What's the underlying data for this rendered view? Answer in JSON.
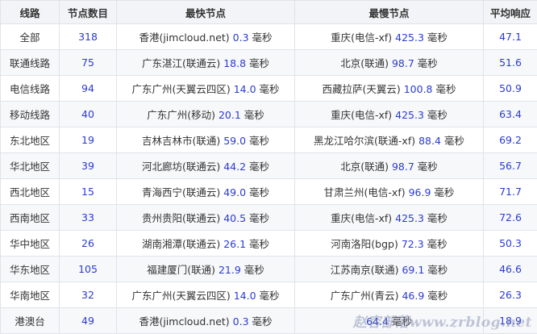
{
  "headers": [
    "线路",
    "节点数目",
    "最快节点",
    "最慢节点",
    "平均响应"
  ],
  "rows": [
    {
      "line": "全部",
      "count": "318",
      "fast_name": "香港(jimcloud.net)",
      "fast_ms": "0.3",
      "slow_name": "重庆(电信-xf)",
      "slow_ms": "425.3",
      "avg": "47.1"
    },
    {
      "line": "联通线路",
      "count": "75",
      "fast_name": "广东湛江(联通云)",
      "fast_ms": "18.8",
      "slow_name": "北京(联通)",
      "slow_ms": "98.7",
      "avg": "51.6"
    },
    {
      "line": "电信线路",
      "count": "94",
      "fast_name": "广东广州(天翼云四区)",
      "fast_ms": "14.0",
      "slow_name": "西藏拉萨(天翼云)",
      "slow_ms": "100.8",
      "avg": "50.9"
    },
    {
      "line": "移动线路",
      "count": "40",
      "fast_name": "广东广州(移动)",
      "fast_ms": "20.1",
      "slow_name": "重庆(电信-xf)",
      "slow_ms": "425.3",
      "avg": "63.4"
    },
    {
      "line": "东北地区",
      "count": "19",
      "fast_name": "吉林吉林市(联通)",
      "fast_ms": "59.0",
      "slow_name": "黑龙江哈尔滨(联通-xf)",
      "slow_ms": "88.4",
      "avg": "69.2"
    },
    {
      "line": "华北地区",
      "count": "39",
      "fast_name": "河北廊坊(联通云)",
      "fast_ms": "44.2",
      "slow_name": "北京(联通)",
      "slow_ms": "98.7",
      "avg": "56.7"
    },
    {
      "line": "西北地区",
      "count": "15",
      "fast_name": "青海西宁(联通云)",
      "fast_ms": "49.0",
      "slow_name": "甘肃兰州(电信-xf)",
      "slow_ms": "96.9",
      "avg": "71.7"
    },
    {
      "line": "西南地区",
      "count": "33",
      "fast_name": "贵州贵阳(联通云)",
      "fast_ms": "40.5",
      "slow_name": "重庆(电信-xf)",
      "slow_ms": "425.3",
      "avg": "72.6"
    },
    {
      "line": "华中地区",
      "count": "26",
      "fast_name": "湖南湘潭(联通云)",
      "fast_ms": "26.1",
      "slow_name": "河南洛阳(bgp)",
      "slow_ms": "72.3",
      "avg": "50.3"
    },
    {
      "line": "华东地区",
      "count": "105",
      "fast_name": "福建厦门(联通)",
      "fast_ms": "21.9",
      "slow_name": "江苏南京(联通)",
      "slow_ms": "69.1",
      "avg": "46.6"
    },
    {
      "line": "华南地区",
      "count": "32",
      "fast_name": "广东广州(天翼云四区)",
      "fast_ms": "14.0",
      "slow_name": "广东广州(青云)",
      "slow_ms": "46.9",
      "avg": "26.3"
    },
    {
      "line": "港澳台",
      "count": "49",
      "fast_name": "香港(jimcloud.net)",
      "fast_ms": "0.3",
      "slow_name": "",
      "slow_ms": "64.4",
      "avg": "18.9"
    }
  ],
  "unit": "毫秒",
  "watermark": "赵容部落www.zrblog.net"
}
